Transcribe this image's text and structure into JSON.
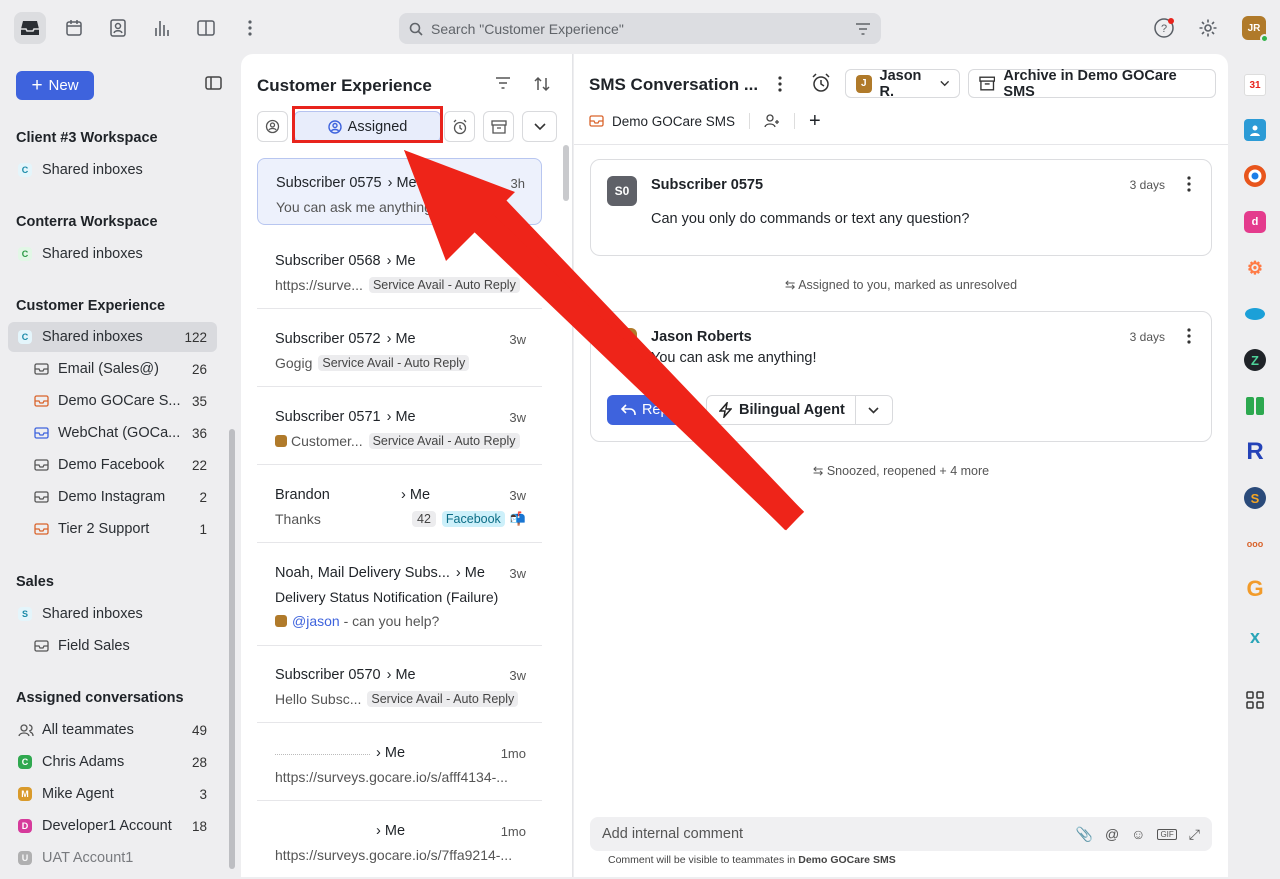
{
  "search": {
    "placeholder": "Search \"Customer Experience\""
  },
  "top": {
    "avatar": "JR"
  },
  "sidebar": {
    "new_label": "New",
    "groups": [
      {
        "title": "Client #3 Workspace",
        "items": [
          {
            "label": "Shared inboxes",
            "badge": "C",
            "badge_color": "#e4f5fb"
          }
        ]
      },
      {
        "title": "Conterra Workspace",
        "items": [
          {
            "label": "Shared inboxes",
            "badge": "C",
            "badge_color": "#e2f7e6"
          }
        ]
      },
      {
        "title": "Customer Experience",
        "items": [
          {
            "label": "Shared inboxes",
            "count": "122",
            "badge": "C"
          },
          {
            "label": "Email (Sales@)",
            "count": "26"
          },
          {
            "label": "Demo GOCare S...",
            "count": "35"
          },
          {
            "label": "WebChat (GOCa...",
            "count": "36"
          },
          {
            "label": "Demo Facebook",
            "count": "22"
          },
          {
            "label": "Demo Instagram",
            "count": "2"
          },
          {
            "label": "Tier 2 Support",
            "count": "1"
          }
        ]
      },
      {
        "title": "Sales",
        "items": [
          {
            "label": "Shared inboxes",
            "badge": "S"
          },
          {
            "label": "Field Sales"
          }
        ]
      },
      {
        "title": "Assigned conversations",
        "items": [
          {
            "label": "All teammates",
            "count": "49"
          },
          {
            "label": "Chris Adams",
            "count": "28",
            "badge": "C"
          },
          {
            "label": "Mike Agent",
            "count": "3",
            "badge": "M"
          },
          {
            "label": "Developer1 Account",
            "count": "18",
            "badge": "D"
          },
          {
            "label": "UAT Account1",
            "badge": "U"
          }
        ]
      }
    ]
  },
  "list": {
    "title": "Customer Experience",
    "assigned_label": "Assigned",
    "conversations": [
      {
        "from": "Subscriber 0575",
        "me": "Me",
        "time": "3h",
        "preview": "You can ask me anything!"
      },
      {
        "from": "Subscriber 0568",
        "me": "Me",
        "time": "3w",
        "preview": "https://surve...",
        "tag": "Service Avail - Auto Reply"
      },
      {
        "from": "Subscriber 0572",
        "me": "Me",
        "time": "3w",
        "preview": "Gogig",
        "tag": "Service Avail - Auto Reply"
      },
      {
        "from": "Subscriber 0571",
        "me": "Me",
        "time": "3w",
        "preview": "Customer...",
        "tag": "Service Avail - Auto Reply"
      },
      {
        "from": "Brandon",
        "me": "Me",
        "time": "3w",
        "preview": "Thanks",
        "count": "42",
        "tag": "Facebook"
      },
      {
        "from": "Noah, Mail Delivery Subs...",
        "me": "Me",
        "time": "3w",
        "preview": "Delivery Status Notification (Failure)",
        "mention": "@jason",
        "mention_rest": " - can you help?"
      },
      {
        "from": "Subscriber 0570",
        "me": "Me",
        "time": "3w",
        "preview": "Hello Subsc...",
        "tag": "Service Avail - Auto Reply"
      },
      {
        "from": "",
        "me": "Me",
        "time": "1mo",
        "preview": "https://surveys.gocare.io/s/afff4134-..."
      },
      {
        "from": "",
        "me": "Me",
        "time": "1mo",
        "preview": "https://surveys.gocare.io/s/7ffa9214-..."
      }
    ]
  },
  "main": {
    "title": "SMS Conversation ...",
    "assignee": "Jason R.",
    "assignee_initial": "J",
    "archive_label": "Archive in Demo GOCare SMS",
    "inbox": "Demo GOCare SMS",
    "msg1": {
      "avatar": "S0",
      "from": "Subscriber 0575",
      "time": "3 days",
      "body": "Can you only do commands or text any question?"
    },
    "sys1": "Assigned to you, marked as unresolved",
    "msg2": {
      "avatar": "JR",
      "from": "Jason Roberts",
      "time": "3 days",
      "body": "You can ask me anything!"
    },
    "reply_label": "Reply",
    "agent_label": "Bilingual Agent",
    "sys2": "Snoozed, reopened + 4 more",
    "composer_placeholder": "Add internal comment",
    "footer_note": "Comment will be visible to teammates in ",
    "footer_inbox": "Demo GOCare SMS"
  },
  "rail": {
    "calendar_day": "31"
  }
}
